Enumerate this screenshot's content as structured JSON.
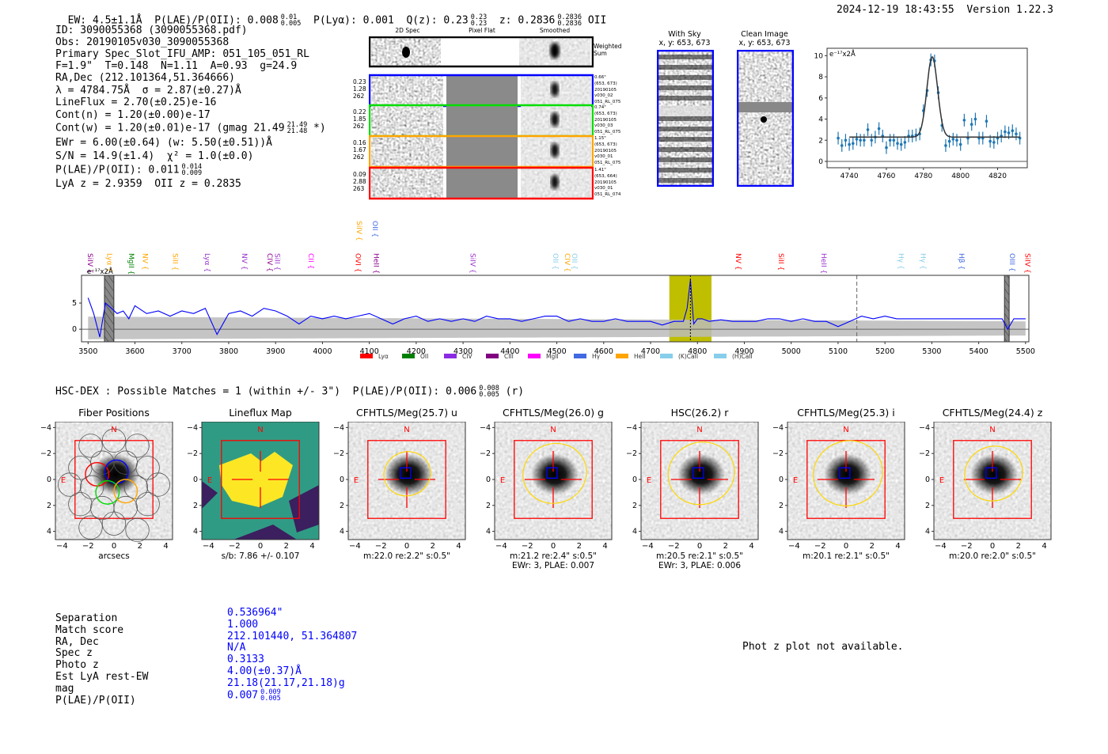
{
  "header": {
    "ew": "EW: 4.5±1.1Å",
    "plae": "P(LAE)/P(OII): 0.008",
    "plae_hi": "0.01",
    "plae_lo": "0.005",
    "plya": "P(Lyα): 0.001",
    "qz": "Q(z): 0.23",
    "qz_hi": "0.23",
    "qz_lo": "0.23",
    "z": "z: 0.2836",
    "z_hi": "0.2836",
    "z_lo": "0.2836",
    "z_line": "OII",
    "datetime": "2024-12-19 18:43:55",
    "version": "Version 1.22.3"
  },
  "info": [
    {
      "text": "ID: 3090055368 (3090055368.pdf)"
    },
    {
      "text": "Obs: 20190105v030_3090055368"
    },
    {
      "text": "Primary Spec_Slot_IFU_AMP: 051_105_051_RL"
    },
    {
      "text": "F=1.9\"  T=0.148  N=1.11  A=0.93  g=24.9"
    },
    {
      "text": "RA,Dec (212.101364,51.364666)"
    },
    {
      "text": "λ = 4784.75Å  σ = 2.87(±0.27)Å"
    },
    {
      "text": "LineFlux = 2.70(±0.25)e-16"
    },
    {
      "text": "Cont(n) = 1.20(±0.00)e-17"
    },
    {
      "text": "Cont(w) = 1.20(±0.01)e-17 (gmag 21.49",
      "hi": "21.49",
      "lo": "21.48",
      "tail": " *)"
    },
    {
      "text": "EWr = 6.00(±0.64) (w: 5.50(±0.51))Å"
    },
    {
      "text": "S/N = 14.9(±1.4)  χ² = 1.0(±0.0)"
    },
    {
      "text": "P(LAE)/P(OII): 0.011",
      "hi": "0.014",
      "lo": "0.009"
    },
    {
      "text": "LyA z = 2.9359  OII z = 0.2835"
    }
  ],
  "spec2d": {
    "headers": [
      "2D Spec",
      "Pixel Flat",
      "Smoothed"
    ],
    "weighted_sum": "Weighted Sum",
    "rows": [
      {
        "color": "#0000ff",
        "left": [
          "0.23",
          "1.28",
          "262"
        ],
        "right": [
          "0.66\"",
          "(653, 673)",
          "20190105",
          "v030_02",
          "051_RL_075"
        ]
      },
      {
        "color": "#00dd00",
        "left": [
          "0.22",
          "1.85",
          "262"
        ],
        "right": [
          "0.74\"",
          "(653, 673)",
          "20190105",
          "v030_03",
          "051_RL_075"
        ]
      },
      {
        "color": "#ffa500",
        "left": [
          "0.16",
          "1.67",
          "262"
        ],
        "right": [
          "1.15\"",
          "(653, 673)",
          "20190105",
          "v030_01",
          "051_RL_075"
        ]
      },
      {
        "color": "#ff0000",
        "left": [
          "0.09",
          "2.88",
          "263"
        ],
        "right": [
          "1.41\"",
          "(653, 664)",
          "20190105",
          "v030_01",
          "051_RL_074"
        ]
      }
    ]
  },
  "ccd": {
    "with_sky": [
      "With Sky",
      "x, y: 653, 673"
    ],
    "clean": [
      "Clean Image",
      "x, y: 653, 673"
    ]
  },
  "chart_data": [
    {
      "type": "scatter",
      "unit_label": "e⁻¹⁷x2Å",
      "xlim": [
        4728,
        4836
      ],
      "ylim": [
        -0.6,
        10.7
      ],
      "xticks": [
        4740,
        4760,
        4780,
        4800,
        4820
      ],
      "yticks": [
        0,
        2,
        4,
        6,
        8,
        10
      ],
      "x": [
        4734,
        4736,
        4738,
        4740,
        4742,
        4744,
        4746,
        4748,
        4750,
        4752,
        4754,
        4756,
        4758,
        4760,
        4762,
        4764,
        4766,
        4768,
        4770,
        4772,
        4774,
        4776,
        4778,
        4780,
        4782,
        4784,
        4786,
        4788,
        4790,
        4792,
        4794,
        4796,
        4798,
        4800,
        4802,
        4804,
        4806,
        4808,
        4810,
        4812,
        4814,
        4816,
        4818,
        4820,
        4822,
        4824,
        4826,
        4828,
        4830,
        4832
      ],
      "y": [
        2.2,
        1.5,
        2.0,
        1.6,
        1.7,
        2.1,
        2.0,
        2.0,
        3.0,
        2.0,
        2.3,
        3.1,
        2.4,
        1.3,
        2.0,
        2.0,
        1.7,
        1.6,
        1.8,
        2.4,
        2.4,
        2.5,
        2.6,
        4.8,
        6.7,
        9.6,
        9.5,
        6.5,
        3.4,
        1.5,
        1.9,
        2.1,
        2.0,
        1.6,
        3.9,
        2.2,
        3.5,
        4.0,
        2.2,
        2.2,
        3.8,
        1.9,
        1.8,
        2.2,
        2.4,
        2.8,
        2.7,
        2.9,
        2.6,
        2.2
      ],
      "yerr": 0.6,
      "fit": {
        "model": "gaussian",
        "center": 4784.75,
        "sigma": 2.87,
        "continuum": 2.3,
        "amplitude": 7.6,
        "range": [
          4740,
          4832
        ]
      },
      "colors": {
        "points": "#1f77b4",
        "fit": "#333333"
      }
    },
    {
      "type": "line",
      "unit_label": "e⁻¹⁷x2Å",
      "xlim": [
        3486,
        5507
      ],
      "ylim": [
        -2.4,
        10.3
      ],
      "xticks": [
        3500,
        3600,
        3700,
        3800,
        3900,
        4000,
        4100,
        4200,
        4300,
        4400,
        4500,
        4600,
        4700,
        4800,
        4900,
        5000,
        5100,
        5200,
        5300,
        5400,
        5500
      ],
      "yticks": [
        0,
        5
      ],
      "x": [
        3500,
        3512,
        3525,
        3537,
        3550,
        3562,
        3575,
        3587,
        3600,
        3625,
        3650,
        3675,
        3700,
        3725,
        3750,
        3775,
        3800,
        3825,
        3850,
        3875,
        3900,
        3925,
        3950,
        3975,
        4000,
        4025,
        4050,
        4075,
        4100,
        4125,
        4150,
        4175,
        4200,
        4225,
        4250,
        4275,
        4300,
        4325,
        4350,
        4375,
        4400,
        4425,
        4450,
        4475,
        4500,
        4525,
        4550,
        4575,
        4600,
        4625,
        4650,
        4675,
        4700,
        4725,
        4750,
        4770,
        4778,
        4785,
        4792,
        4800,
        4810,
        4825,
        4850,
        4875,
        4900,
        4925,
        4950,
        4975,
        5000,
        5025,
        5050,
        5075,
        5100,
        5125,
        5150,
        5175,
        5200,
        5225,
        5250,
        5275,
        5300,
        5325,
        5350,
        5375,
        5400,
        5425,
        5450,
        5462,
        5475,
        5500
      ],
      "y": [
        6,
        3,
        -1.5,
        5,
        4,
        3,
        3.5,
        2,
        4.5,
        3,
        3.5,
        2.5,
        3.5,
        3,
        4,
        -1,
        3,
        3.5,
        2.5,
        4,
        3.5,
        2.5,
        1,
        2.5,
        2,
        2.5,
        2,
        2.5,
        3,
        2,
        1,
        2,
        2.5,
        1.5,
        2,
        1.5,
        2,
        1.5,
        2.5,
        2,
        2,
        1.5,
        2,
        2.5,
        2.5,
        1.5,
        2,
        1.5,
        1.5,
        2,
        1.5,
        1.5,
        1.5,
        0.8,
        1.5,
        1.5,
        4,
        9.5,
        1,
        2,
        2,
        1.5,
        1.8,
        1.5,
        1.5,
        1.5,
        2,
        2,
        1.5,
        2,
        1.5,
        1.5,
        0.5,
        1.5,
        2.5,
        2,
        2.5,
        2,
        2,
        2,
        2,
        2,
        2,
        2,
        2,
        2,
        2,
        0,
        2,
        2
      ],
      "noise_band": 1.5,
      "highlight_range": [
        4740,
        4830
      ],
      "line_marker": 4785,
      "dashed_marker": 5140,
      "masked_ranges": [
        [
          3535,
          3555
        ],
        [
          5455,
          5465
        ]
      ],
      "colors": {
        "spectrum": "#0000ff",
        "noise": "#bbbbbb",
        "highlight": "#bfbf00"
      },
      "line_labels": [
        {
          "name": "SiIV",
          "wave": 3503,
          "color": "#8b008b"
        },
        {
          "name": "Lyα",
          "wave": 3544,
          "color": "#ffa500"
        },
        {
          "name": "MgII",
          "wave": 3591,
          "color": "#008000"
        },
        {
          "name": "NV",
          "wave": 3620,
          "color": "#ffa500"
        },
        {
          "name": "SiII",
          "wave": 3684,
          "color": "#ffa500"
        },
        {
          "name": "Lyα",
          "wave": 3753,
          "color": "#9932cc"
        },
        {
          "name": "NV",
          "wave": 3832,
          "color": "#9932cc"
        },
        {
          "name": "CIV",
          "wave": 3886,
          "color": "#8b008b"
        },
        {
          "name": "SiII",
          "wave": 3902,
          "color": "#9932cc"
        },
        {
          "name": "CII",
          "wave": 3974,
          "color": "#ff00ff"
        },
        {
          "name": "OVI",
          "wave": 4074,
          "color": "#ff0000"
        },
        {
          "name": "HeII",
          "wave": 4113,
          "color": "#8b008b"
        },
        {
          "name": "SiIV",
          "wave": 4077,
          "color": "#ffa500",
          "raised": true
        },
        {
          "name": "OII",
          "wave": 4111,
          "color": "#4169e1",
          "raised": true
        },
        {
          "name": "SiIV",
          "wave": 4319,
          "color": "#9932cc"
        },
        {
          "name": "OII",
          "wave": 4496,
          "color": "#87ceeb"
        },
        {
          "name": "CIV",
          "wave": 4521,
          "color": "#ffa500"
        },
        {
          "name": "OII",
          "wave": 4536,
          "color": "#87ceeb"
        },
        {
          "name": "NV",
          "wave": 4886,
          "color": "#ff0000"
        },
        {
          "name": "SiII",
          "wave": 4977,
          "color": "#ff0000"
        },
        {
          "name": "HeII",
          "wave": 5068,
          "color": "#9932cc"
        },
        {
          "name": "Hγ",
          "wave": 5233,
          "color": "#87ceeb"
        },
        {
          "name": "Hγ",
          "wave": 5280,
          "color": "#87ceeb"
        },
        {
          "name": "Hβ",
          "wave": 5362,
          "color": "#4169e1"
        },
        {
          "name": "OIII",
          "wave": 5470,
          "color": "#4169e1"
        },
        {
          "name": "SiIV",
          "wave": 5503,
          "color": "#ff0000"
        }
      ],
      "legend": [
        {
          "name": "Lyα",
          "color": "#ff0000"
        },
        {
          "name": "OII",
          "color": "#008000"
        },
        {
          "name": "CIV",
          "color": "#8a2be2"
        },
        {
          "name": "CIII",
          "color": "#800080"
        },
        {
          "name": "MgII",
          "color": "#ff00ff"
        },
        {
          "name": "Hγ",
          "color": "#4169e1"
        },
        {
          "name": "HeII",
          "color": "#ffa500"
        },
        {
          "name": "(K)CaII",
          "color": "#87ceeb"
        },
        {
          "name": "(H)CaII",
          "color": "#87ceeb"
        }
      ]
    }
  ],
  "catalog": {
    "heading": "HSC-DEX : Possible Matches = 1 (within +/- 3\")  P(LAE)/P(OII): 0.006",
    "heading_hi": "0.008",
    "heading_lo": "0.005",
    "heading_tail": " (r)",
    "compass": {
      "n": "N",
      "e": "E"
    },
    "xticks": [
      "−4",
      "−2",
      "0",
      "2",
      "4"
    ],
    "yticks": [
      "4",
      "2",
      "0",
      "−2",
      "−4"
    ],
    "cutouts": [
      {
        "title": "Fiber Positions",
        "sub": [
          "arcsecs"
        ],
        "kind": "fibers"
      },
      {
        "title": "Lineflux Map",
        "sub": [
          "s/b: 7.86 +/- 0.107"
        ],
        "kind": "lineflux"
      },
      {
        "title": "CFHTLS/Meg(25.7) u",
        "sub": [
          "m:22.0  re:2.2\"  s:0.5\""
        ],
        "kind": "image",
        "blob": 0.6
      },
      {
        "title": "CFHTLS/Meg(26.0) g",
        "sub": [
          "m:21.2  re:2.4\"  s:0.5\"",
          "EWr: 3, PLAE: 0.007"
        ],
        "kind": "image",
        "blob": 0.9
      },
      {
        "title": "HSC(26.2) r",
        "sub": [
          "m:20.5  re:2.1\"  s:0.5\"",
          "EWr: 3, PLAE: 0.006"
        ],
        "kind": "image",
        "blob": 0.95
      },
      {
        "title": "CFHTLS/Meg(25.3) i",
        "sub": [
          "m:20.1  re:2.1\"  s:0.5\""
        ],
        "kind": "image",
        "blob": 1.0
      },
      {
        "title": "CFHTLS/Meg(24.4) z",
        "sub": [
          "m:20.0  re:2.0\"  s:0.5\""
        ],
        "kind": "image",
        "blob": 0.8
      }
    ]
  },
  "match_table": {
    "rows": [
      {
        "label": "Separation",
        "value": "0.536964\""
      },
      {
        "label": "Match score",
        "value": "1.000"
      },
      {
        "label": "RA, Dec",
        "value": "212.101440, 51.364807"
      },
      {
        "label": "Spec z",
        "value": "N/A"
      },
      {
        "label": "Photo z",
        "value": "0.3133"
      },
      {
        "label": "Est LyA rest-EW",
        "value": "4.00(±0.37)Å"
      },
      {
        "label": "mag",
        "value": "21.18(21.17,21.18)g"
      },
      {
        "label": "P(LAE)/P(OII)",
        "value": "0.007",
        "hi": "0.009",
        "lo": "0.005"
      }
    ]
  },
  "photz_message": "Phot z plot not available."
}
